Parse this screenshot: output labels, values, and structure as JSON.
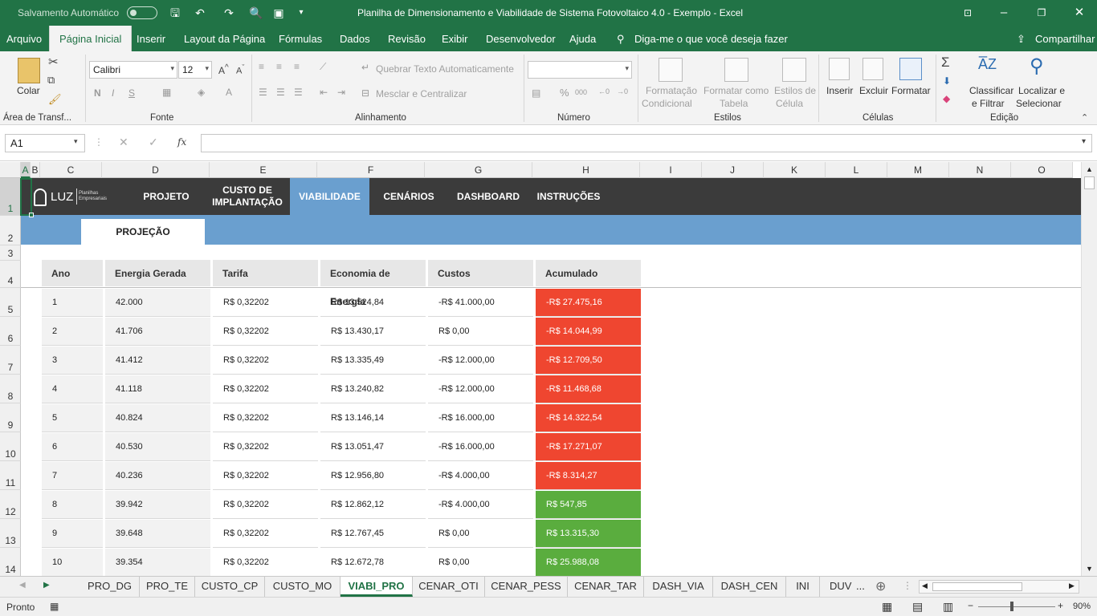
{
  "titlebar": {
    "autosave_label": "Salvamento Automático",
    "title": "Planilha de Dimensionamento e Viabilidade de Sistema Fotovoltaico 4.0 - Exemplo  -  Excel"
  },
  "menu": [
    "Arquivo",
    "Página Inicial",
    "Inserir",
    "Layout da Página",
    "Fórmulas",
    "Dados",
    "Revisão",
    "Exibir",
    "Desenvolvedor",
    "Ajuda"
  ],
  "tell_me": "Diga-me o que você deseja fazer",
  "share": "Compartilhar",
  "ribbon": {
    "paste_label": "Colar",
    "clipboard_group": "Área de Transf...",
    "font_name": "Calibri",
    "font_size": "12",
    "font_group": "Fonte",
    "wrap_text": "Quebrar Texto Automaticamente",
    "merge_center": "Mesclar e Centralizar",
    "alignment_group": "Alinhamento",
    "number_group": "Número",
    "cond_format": [
      "Formatação",
      "Condicional"
    ],
    "format_table": [
      "Formatar como",
      "Tabela"
    ],
    "cell_styles": [
      "Estilos de",
      "Célula"
    ],
    "styles_group": "Estilos",
    "insert": "Inserir",
    "delete": "Excluir",
    "format": "Formatar",
    "cells_group": "Células",
    "sort_filter": [
      "Classificar",
      "e Filtrar"
    ],
    "find_select": [
      "Localizar e",
      "Selecionar"
    ],
    "editing_group": "Edição"
  },
  "formula_bar": {
    "name_box": "A1",
    "fx": "fx"
  },
  "columns": [
    {
      "l": "A",
      "w": 12
    },
    {
      "l": "B",
      "w": 12
    },
    {
      "l": "C",
      "w": 77
    },
    {
      "l": "D",
      "w": 134
    },
    {
      "l": "E",
      "w": 134
    },
    {
      "l": "F",
      "w": 134
    },
    {
      "l": "G",
      "w": 134
    },
    {
      "l": "H",
      "w": 134
    },
    {
      "l": "I",
      "w": 77
    },
    {
      "l": "J",
      "w": 77
    },
    {
      "l": "K",
      "w": 77
    },
    {
      "l": "L",
      "w": 77
    },
    {
      "l": "M",
      "w": 77
    },
    {
      "l": "N",
      "w": 77
    },
    {
      "l": "O",
      "w": 77
    }
  ],
  "rows": [
    "1",
    "2",
    "3",
    "4",
    "5",
    "6",
    "7",
    "8",
    "9",
    "10",
    "11",
    "12",
    "13",
    "14"
  ],
  "logo": {
    "brand": "LUZ",
    "sub": "Planilhas Empresariais"
  },
  "nav": [
    {
      "label": "PROJETO",
      "active": false
    },
    {
      "label": "CUSTO DE IMPLANTAÇÃO",
      "active": false
    },
    {
      "label": "VIABILIDADE",
      "active": true
    },
    {
      "label": "CENÁRIOS",
      "active": false
    },
    {
      "label": "DASHBOARD",
      "active": false
    },
    {
      "label": "INSTRUÇÕES",
      "active": false
    }
  ],
  "subtab": "PROJEÇÃO",
  "table": {
    "headers": [
      "Ano",
      "Energia Gerada",
      "Tarifa",
      "Economia de Energia",
      "Custos",
      "Acumulado"
    ],
    "rows": [
      [
        "1",
        "42.000",
        "R$ 0,32202",
        "R$ 13.524,84",
        "-R$ 41.000,00",
        "-R$ 27.475,16"
      ],
      [
        "2",
        "41.706",
        "R$ 0,32202",
        "R$ 13.430,17",
        "R$ 0,00",
        "-R$ 14.044,99"
      ],
      [
        "3",
        "41.412",
        "R$ 0,32202",
        "R$ 13.335,49",
        "-R$ 12.000,00",
        "-R$ 12.709,50"
      ],
      [
        "4",
        "41.118",
        "R$ 0,32202",
        "R$ 13.240,82",
        "-R$ 12.000,00",
        "-R$ 11.468,68"
      ],
      [
        "5",
        "40.824",
        "R$ 0,32202",
        "R$ 13.146,14",
        "-R$ 16.000,00",
        "-R$ 14.322,54"
      ],
      [
        "6",
        "40.530",
        "R$ 0,32202",
        "R$ 13.051,47",
        "-R$ 16.000,00",
        "-R$ 17.271,07"
      ],
      [
        "7",
        "40.236",
        "R$ 0,32202",
        "R$ 12.956,80",
        "-R$ 4.000,00",
        "-R$ 8.314,27"
      ],
      [
        "8",
        "39.942",
        "R$ 0,32202",
        "R$ 12.862,12",
        "-R$ 4.000,00",
        "R$ 547,85"
      ],
      [
        "9",
        "39.648",
        "R$ 0,32202",
        "R$ 12.767,45",
        "R$ 0,00",
        "R$ 13.315,30"
      ],
      [
        "10",
        "39.354",
        "R$ 0,32202",
        "R$ 12.672,78",
        "R$ 0,00",
        "R$ 25.988,08"
      ]
    ],
    "negative_color": "#ef4630",
    "positive_color": "#5aad3e"
  },
  "sheet_tabs": [
    {
      "label": "PRO_DG",
      "active": false
    },
    {
      "label": "PRO_TE",
      "active": false
    },
    {
      "label": "CUSTO_CP",
      "active": false
    },
    {
      "label": "CUSTO_MO",
      "active": false
    },
    {
      "label": "VIABI_PRO",
      "active": true
    },
    {
      "label": "CENAR_OTI",
      "active": false
    },
    {
      "label": "CENAR_PESS",
      "active": false
    },
    {
      "label": "CENAR_TAR",
      "active": false
    },
    {
      "label": "DASH_VIA",
      "active": false
    },
    {
      "label": "DASH_CEN",
      "active": false
    },
    {
      "label": "INI",
      "active": false
    },
    {
      "label": "DUV",
      "active": false
    }
  ],
  "status": {
    "ready": "Pronto",
    "zoom": "90%"
  },
  "colors": {
    "excel_green": "#217346",
    "nav_dark": "#3b3b3b",
    "nav_active": "#6a9fcf"
  }
}
